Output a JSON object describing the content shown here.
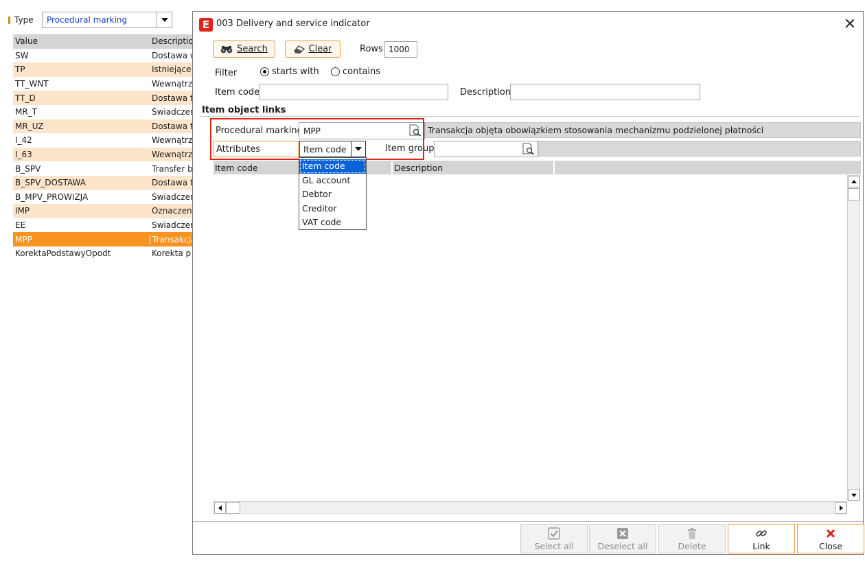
{
  "background": {
    "type_label": "Type",
    "type_value": "Procedural marking",
    "columns": [
      "Value",
      "Descriptio"
    ],
    "rows": [
      {
        "value": "SW",
        "desc": "Dostawa w"
      },
      {
        "value": "TP",
        "desc": "Istniejące"
      },
      {
        "value": "TT_WNT",
        "desc": "Wewnątrz"
      },
      {
        "value": "TT_D",
        "desc": "Dostawa t"
      },
      {
        "value": "MR_T",
        "desc": "Świadczen"
      },
      {
        "value": "MR_UZ",
        "desc": "Dostawa t"
      },
      {
        "value": "I_42",
        "desc": "Wewnątrz"
      },
      {
        "value": "I_63",
        "desc": "Wewnątrz"
      },
      {
        "value": "B_SPV",
        "desc": "Transfer b"
      },
      {
        "value": "B_SPV_DOSTAWA",
        "desc": "Dostawa t"
      },
      {
        "value": "B_MPV_PROWIZJA",
        "desc": "Świadczen"
      },
      {
        "value": "IMP",
        "desc": "Oznaczeni"
      },
      {
        "value": "EE",
        "desc": "Świadczen"
      },
      {
        "value": "MPP",
        "desc": "Transakcja"
      },
      {
        "value": "KorektaPodstawyOpodt",
        "desc": "Korekta p"
      }
    ],
    "selected_row": "MPP"
  },
  "dialog": {
    "icon_letter": "E",
    "title": "003 Delivery and service indicator",
    "search_label": "Search",
    "clear_label": "Clear",
    "rows_label": "Rows",
    "rows_value": "1000",
    "filter_label": "Filter",
    "filter_options": [
      "starts with",
      "contains"
    ],
    "filter_selected": "starts with",
    "item_code_label": "Item code",
    "item_code_value": "",
    "description_label": "Description",
    "description_value": "",
    "section_title": "Item object links",
    "procedural_marking_label": "Procedural marking",
    "procedural_marking_value": "MPP",
    "procedural_marking_desc": "Transakcja objęta obowiązkiem stosowania mechanizmu podzielonej płatności",
    "attributes_label": "Attributes",
    "attributes_value": "Item code",
    "attributes_options": [
      "Item code",
      "GL account",
      "Debtor",
      "Creditor",
      "VAT code"
    ],
    "item_group_label": "Item group",
    "item_group_value": "",
    "grid_columns": [
      "Item code",
      "Description"
    ],
    "footer_buttons": [
      {
        "label": "Select all",
        "enabled": false,
        "icon": "checkmark-icon"
      },
      {
        "label": "Deselect all",
        "enabled": false,
        "icon": "x-box-icon"
      },
      {
        "label": "Delete",
        "enabled": false,
        "icon": "trash-icon"
      },
      {
        "label": "Link",
        "enabled": true,
        "icon": "link-icon"
      },
      {
        "label": "Close",
        "enabled": true,
        "icon": "close-x-icon"
      }
    ]
  },
  "colors": {
    "accent_orange": "#f39a33",
    "selected_row": "#f7931e",
    "alt_row": "#fde5cc",
    "highlight_red": "#e2231a",
    "dropdown_active": "#0a64d8",
    "type_value_blue": "#1a3ec9"
  }
}
